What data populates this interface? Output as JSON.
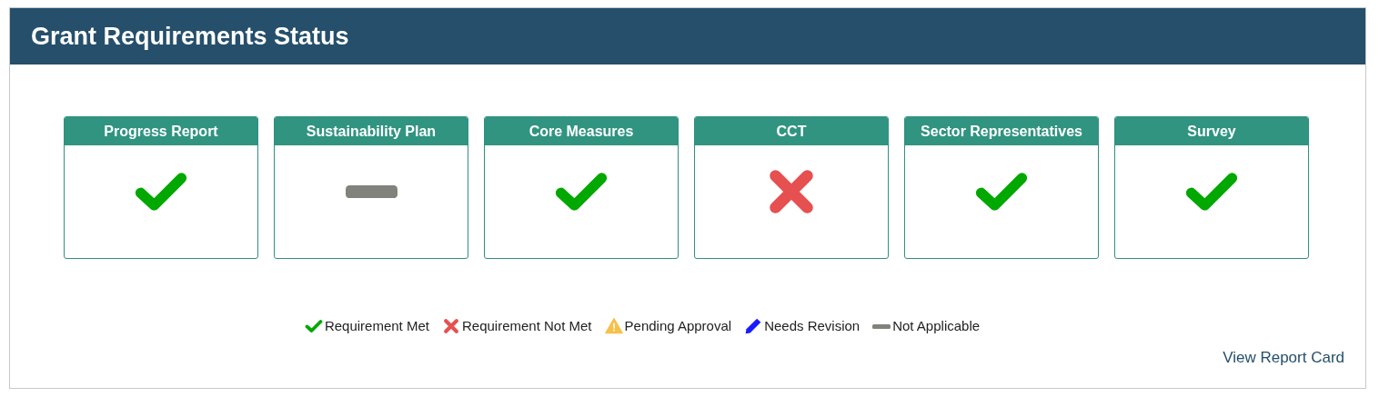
{
  "title": "Grant Requirements Status",
  "cards": [
    {
      "label": "Progress Report",
      "kind": "met"
    },
    {
      "label": "Sustainability Plan",
      "kind": "na"
    },
    {
      "label": "Core Measures",
      "kind": "met"
    },
    {
      "label": "CCT",
      "kind": "not_met"
    },
    {
      "label": "Sector Representatives",
      "kind": "met"
    },
    {
      "label": "Survey",
      "kind": "met"
    }
  ],
  "legend": [
    {
      "kind": "met",
      "label": "Requirement Met"
    },
    {
      "kind": "not_met",
      "label": "Requirement Not Met"
    },
    {
      "kind": "pending",
      "label": "Pending Approval"
    },
    {
      "kind": "revision",
      "label": "Needs Revision"
    },
    {
      "kind": "na",
      "label": "Not Applicable"
    }
  ],
  "link": "View Report Card"
}
